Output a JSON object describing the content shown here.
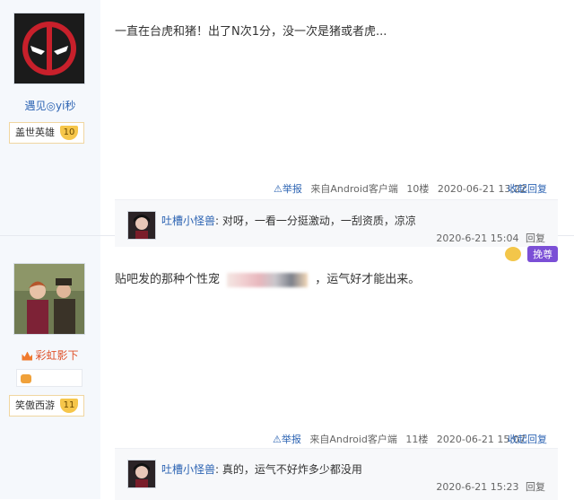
{
  "post1": {
    "username": "遇见◎yi秒",
    "level_title": "盖世英雄",
    "level_num": "10",
    "content": "一直在台虎和猪！出了N次1分，没一次是猪或者虎...",
    "report": "举报",
    "source": "来自Android客户端",
    "floor": "10楼",
    "time": "2020-06-21 13:22",
    "reply_label": "收起回复",
    "reply": {
      "user": "吐槽小怪兽",
      "text": ": 对呀，一看一分挺激动，一刮资质，凉凉",
      "time": "2020-6-21 15:04",
      "reply_label": "回复"
    }
  },
  "post2": {
    "username": "彩虹影下",
    "level_title": "笑傲西游",
    "level_num": "11",
    "content_before": "贴吧发的那种个性宠",
    "content_after": "，运气好才能出来。",
    "report": "举报",
    "source": "来自Android客户端",
    "floor": "11楼",
    "time": "2020-06-21 15:07",
    "reply_label": "收起回复",
    "reply": {
      "user": "吐槽小怪兽",
      "text": ": 真的，运气不好炸多少都没用",
      "time": "2020-6-21 15:23",
      "reply_label": "回复"
    }
  },
  "sticker_label": "挽尊",
  "colors": {
    "link": "#2d64b3",
    "sidebar_bg": "#f5f8fc",
    "badge": "#f6c64a",
    "purple": "#7b4fd6"
  }
}
